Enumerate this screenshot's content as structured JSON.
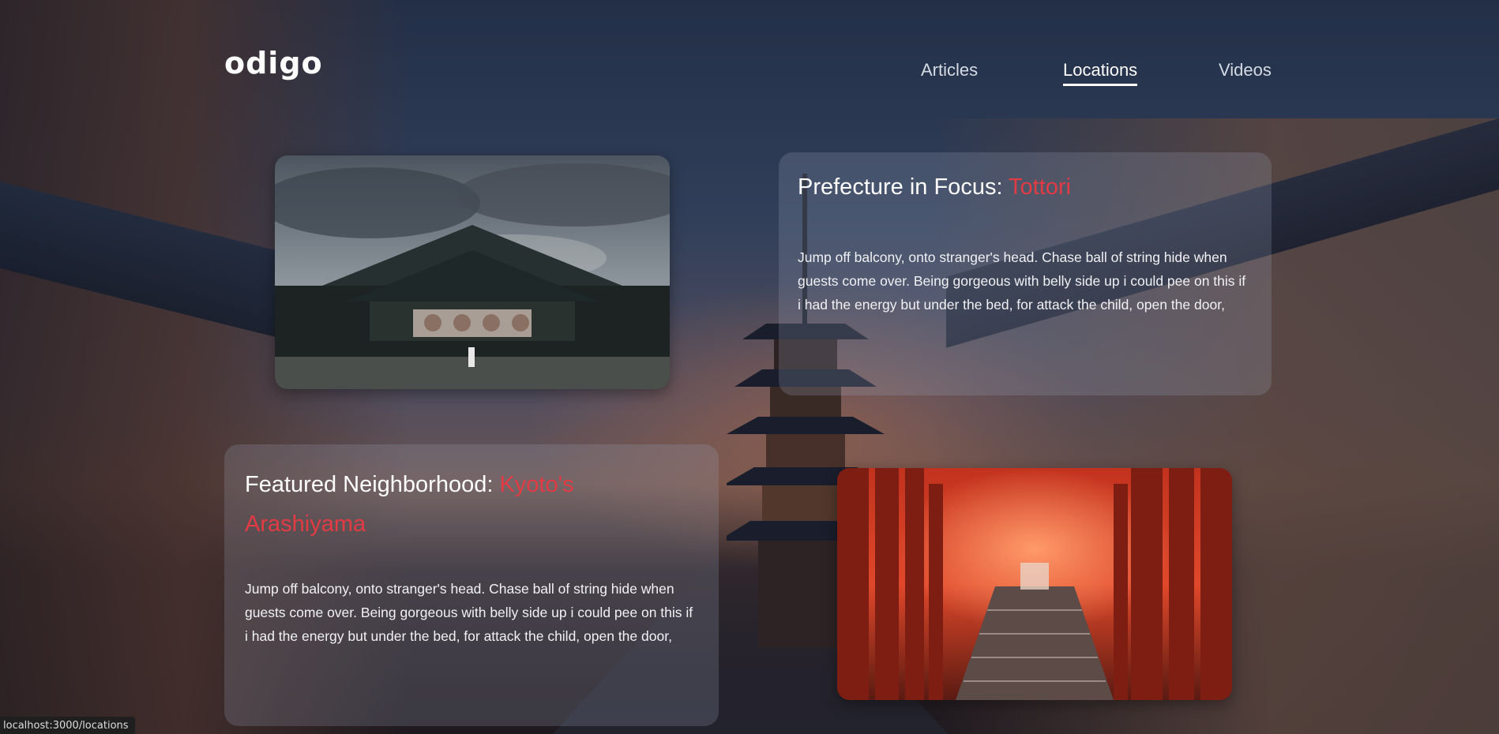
{
  "brand": {
    "logo_text": "odigo"
  },
  "nav": {
    "items": [
      {
        "label": "Articles",
        "active": false
      },
      {
        "label": "Locations",
        "active": true
      },
      {
        "label": "Videos",
        "active": false
      }
    ]
  },
  "sections": {
    "prefecture": {
      "title_prefix": "Prefecture in Focus: ",
      "title_highlight": "Tottori",
      "body": "Jump off balcony, onto stranger's head. Chase ball of string hide when guests come over. Being gorgeous with belly side up i could pee on this if i had the energy but under the bed, for attack the child, open the door,"
    },
    "neighborhood": {
      "title_prefix": "Featured Neighborhood: ",
      "title_highlight": "Kyoto's Arashiyama",
      "body": "Jump off balcony, onto stranger's head. Chase ball of string hide when guests come over. Being gorgeous with belly side up i could pee on this if i had the energy but under the bed, for attack the child, open the door,"
    }
  },
  "status_bar": {
    "url": "localhost:3000/locations"
  },
  "colors": {
    "highlight": "#e23b44",
    "text": "#ffffff",
    "nav_inactive": "#d5dbe4"
  }
}
